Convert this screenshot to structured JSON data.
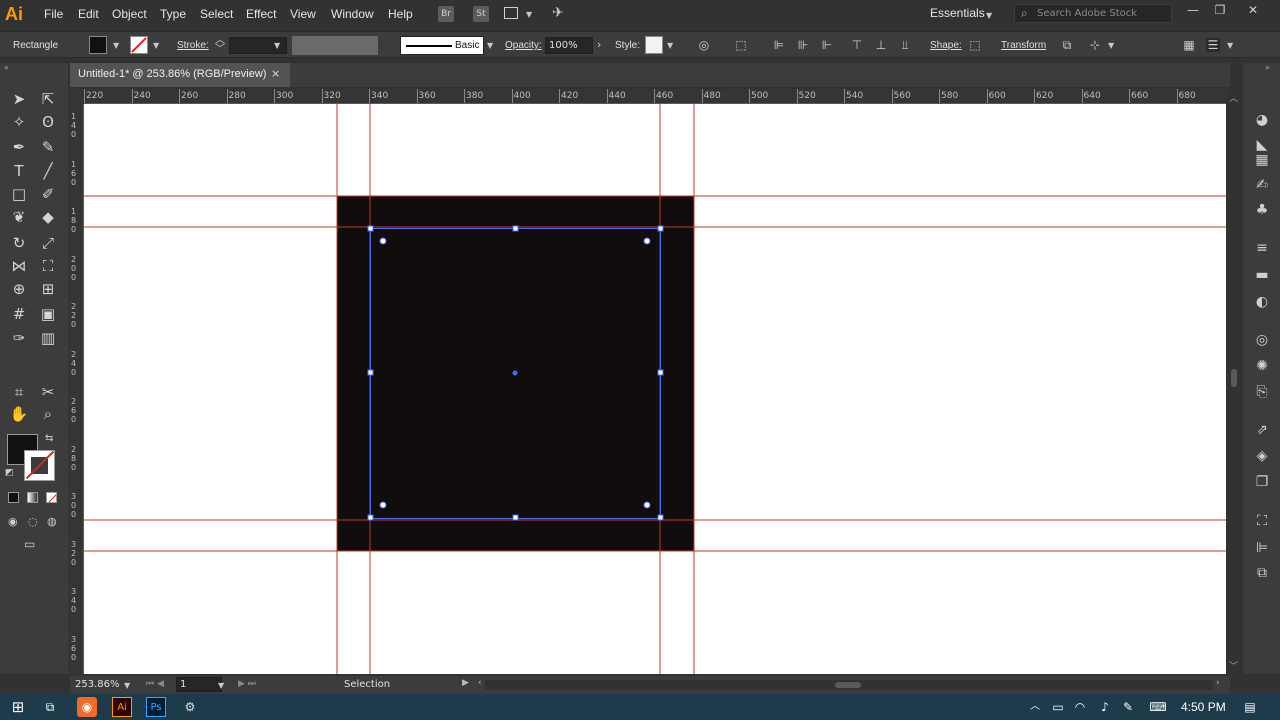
{
  "app": {
    "logo": "Ai"
  },
  "menu": [
    "File",
    "Edit",
    "Object",
    "Type",
    "Select",
    "Effect",
    "View",
    "Window",
    "Help"
  ],
  "menubar": {
    "bridge_icon": "Br",
    "stock_icon": "St",
    "workspace": "Essentials",
    "search_placeholder": "Search Adobe Stock"
  },
  "control": {
    "tool_name": "Rectangle",
    "stroke_label": "Stroke:",
    "brush_label": "Basic",
    "opacity_label": "Opacity:",
    "opacity_value": "100%",
    "style_label": "Style:",
    "shape_label": "Shape:",
    "transform_label": "Transform"
  },
  "tab": {
    "title": "Untitled-1* @ 253.86% (RGB/Preview)",
    "close": "×"
  },
  "rulers": {
    "h_ticks": [
      "220",
      "240",
      "260",
      "280",
      "300",
      "320",
      "340",
      "360",
      "380",
      "400",
      "420",
      "440",
      "460",
      "480",
      "500",
      "520",
      "540",
      "560",
      "580",
      "600",
      "620",
      "640",
      "660",
      "680"
    ],
    "v_ticks": [
      "140",
      "160",
      "180",
      "200",
      "220",
      "240",
      "260",
      "280",
      "300",
      "320",
      "340",
      "360"
    ]
  },
  "status": {
    "zoom": "253.86%",
    "artboard": "1",
    "tool": "Selection"
  },
  "taskbar": {
    "ai_icon": "Ai",
    "ps_icon": "Ps",
    "time": "4:50 PM"
  },
  "colors": {
    "fill": "#110d0d",
    "bleed": "#c0392b",
    "selection": "#4a6cf7",
    "accent": "#ff9a00"
  }
}
